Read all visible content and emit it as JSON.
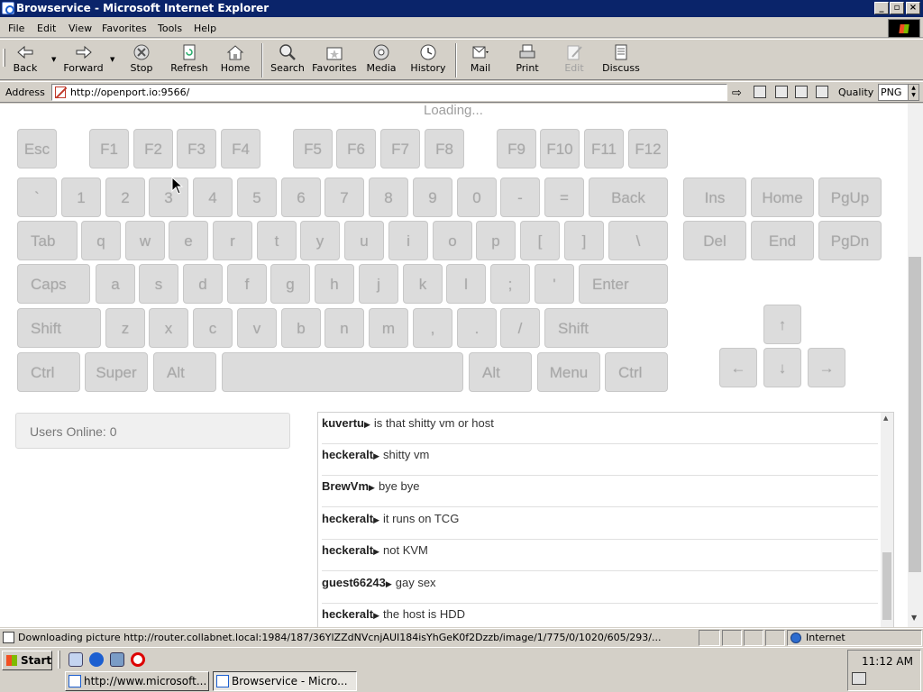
{
  "window": {
    "title": "Browservice - Microsoft Internet Explorer",
    "min": "_",
    "max": "▫",
    "close": "×"
  },
  "menu": [
    "File",
    "Edit",
    "View",
    "Favorites",
    "Tools",
    "Help"
  ],
  "toolbar": {
    "back": "Back",
    "forward": "Forward",
    "stop": "Stop",
    "refresh": "Refresh",
    "home": "Home",
    "search": "Search",
    "favorites": "Favorites",
    "media": "Media",
    "history": "History",
    "mail": "Mail",
    "print": "Print",
    "edit": "Edit",
    "discuss": "Discuss"
  },
  "address": {
    "label": "Address",
    "url": "http://openport.io:9566/",
    "go": "⇨",
    "quality_label": "Quality",
    "quality_value": "PNG"
  },
  "page": {
    "loading": "Loading...",
    "users_online": "Users Online: 0"
  },
  "keyboard": {
    "row0": [
      "Esc",
      "F1",
      "F2",
      "F3",
      "F4",
      "F5",
      "F6",
      "F7",
      "F8",
      "F9",
      "F10",
      "F11",
      "F12"
    ],
    "row1": [
      "`",
      "1",
      "2",
      "3",
      "4",
      "5",
      "6",
      "7",
      "8",
      "9",
      "0",
      "-",
      "=",
      "Back",
      "Ins",
      "Home",
      "PgUp"
    ],
    "row2": [
      "Tab",
      "q",
      "w",
      "e",
      "r",
      "t",
      "y",
      "u",
      "i",
      "o",
      "p",
      "[",
      "]",
      "\\",
      "Del",
      "End",
      "PgDn"
    ],
    "row3": [
      "Caps",
      "a",
      "s",
      "d",
      "f",
      "g",
      "h",
      "j",
      "k",
      "l",
      ";",
      "'",
      "Enter"
    ],
    "row4": [
      "Shift",
      "z",
      "x",
      "c",
      "v",
      "b",
      "n",
      "m",
      ",",
      ".",
      "/",
      "Shift",
      "↑"
    ],
    "row5": [
      "Ctrl",
      "Super",
      "Alt",
      "",
      "Alt",
      "Menu",
      "Ctrl",
      "←",
      "↓",
      "→"
    ]
  },
  "chat": {
    "caret": "▶",
    "messages": [
      {
        "nick": "kuvertu",
        "text": "is that shitty vm or host"
      },
      {
        "nick": "heckeralt",
        "text": "shitty vm"
      },
      {
        "nick": "BrewVm",
        "text": "bye bye"
      },
      {
        "nick": "heckeralt",
        "text": "it runs on TCG"
      },
      {
        "nick": "heckeralt",
        "text": "not KVM"
      },
      {
        "nick": "guest66243",
        "text": "gay sex"
      },
      {
        "nick": "heckeralt",
        "text": "the host is HDD"
      }
    ]
  },
  "status": {
    "text": "Downloading picture http://router.collabnet.local:1984/187/36YlZZdNVcnjAUI184isYhGeK0f2Dzzb/image/1/775/0/1020/605/293/...",
    "zone": "Internet"
  },
  "taskbar": {
    "start": "Start",
    "tasks": [
      "http://www.microsoft...",
      "Browservice - Micro..."
    ],
    "clock": "11:12 AM"
  },
  "colors": {
    "titlebar": "#0a246a",
    "chrome": "#d4d0c8",
    "key_bg": "#dcdcdc",
    "key_text": "#a8a8a8"
  }
}
